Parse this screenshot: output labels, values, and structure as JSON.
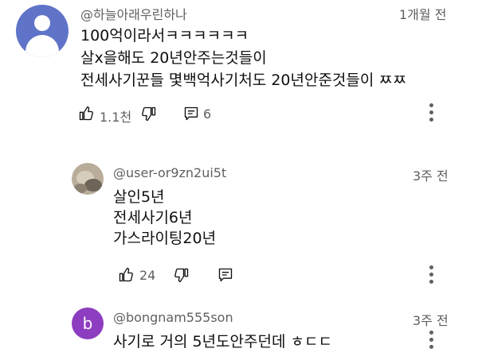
{
  "comments": [
    {
      "handle": "@하늘아래우린하나",
      "time": "1개월 전",
      "lines": [
        "100억이라서ㅋㅋㅋㅋㅋㅋ",
        "살x을해도 20년안주는것들이",
        "전세사기꾼들 몇백억사기처도 20년안준것들이 ㅉㅉ"
      ],
      "likes": "1.1천",
      "replies": "6",
      "avatar_color": "#5f74c8"
    },
    {
      "handle": "@user-or9zn2ui5t",
      "time": "3주 전",
      "lines": [
        "살인5년",
        "전세사기6년",
        "가스라이팅20년"
      ],
      "likes": "24"
    },
    {
      "handle": "@bongnam555son",
      "time": "3주 전",
      "avatar_letter": "b",
      "avatar_color": "#8d3dbf",
      "lines": [
        "사기로 거의 5년도안주던데 ㅎㄷㄷ"
      ]
    }
  ]
}
